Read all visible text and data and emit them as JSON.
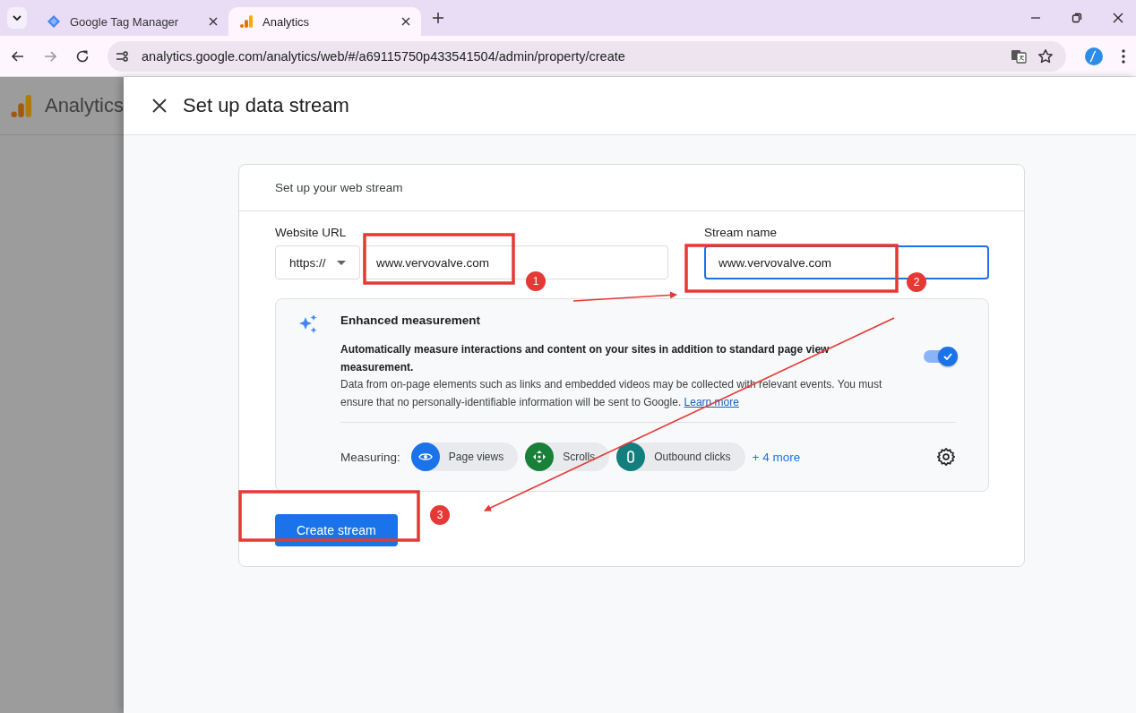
{
  "browser": {
    "tabs": [
      {
        "label": "Google Tag Manager",
        "selected": false,
        "kind": "gtm"
      },
      {
        "label": "Analytics",
        "selected": true,
        "kind": "analytics"
      }
    ],
    "url": "analytics.google.com/analytics/web/#/a69115750p433541504/admin/property/create"
  },
  "backdrop": {
    "app_name": "Analytics"
  },
  "dialog": {
    "title": "Set up data stream",
    "card": {
      "heading": "Set up your web stream",
      "website_url": {
        "label": "Website URL",
        "protocol": "https://",
        "value": "www.vervovalve.com"
      },
      "stream_name": {
        "label": "Stream name",
        "value": "www.vervovalve.com",
        "focused": true
      },
      "enhanced": {
        "title": "Enhanced measurement",
        "lead": "Automatically measure interactions and content on your sites in addition to standard page view measurement.",
        "body": "Data from on-page elements such as links and embedded videos may be collected with relevant events. You must ensure that no personally-identifiable information will be sent to Google.",
        "link": "Learn more",
        "on": true,
        "measuring_label": "Measuring:",
        "chips": [
          {
            "label": "Page views",
            "kind": "eye",
            "color": "#1a73e8"
          },
          {
            "label": "Scrolls",
            "kind": "diamond",
            "color": "#188038"
          },
          {
            "label": "Outbound clicks",
            "kind": "link",
            "color": "#137e7e"
          }
        ],
        "more": "+ 4 more"
      },
      "button": "Create stream"
    }
  },
  "annotations": [
    {
      "label": "1"
    },
    {
      "label": "2"
    },
    {
      "label": "3"
    }
  ]
}
